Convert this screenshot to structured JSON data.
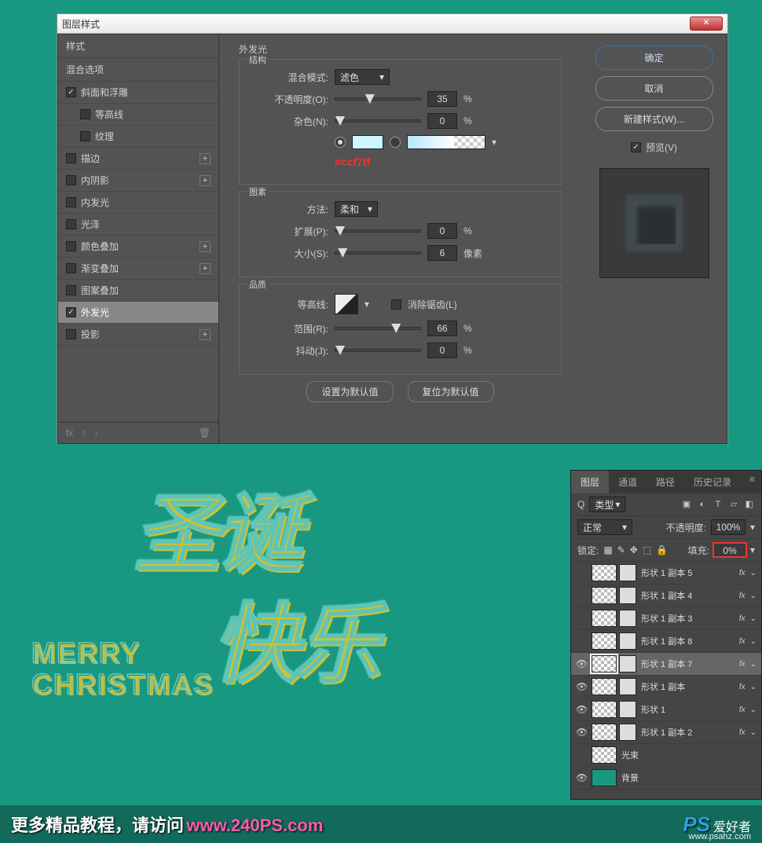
{
  "dialog": {
    "title": "图层样式",
    "close_label": "✕",
    "left": {
      "styles_header": "样式",
      "blend_header": "混合选项",
      "items": [
        {
          "label": "斜面和浮雕",
          "checked": true,
          "plus": false,
          "indent": 0
        },
        {
          "label": "等高线",
          "checked": false,
          "plus": false,
          "indent": 1
        },
        {
          "label": "纹理",
          "checked": false,
          "plus": false,
          "indent": 1
        },
        {
          "label": "描边",
          "checked": false,
          "plus": true,
          "indent": 0
        },
        {
          "label": "内阴影",
          "checked": false,
          "plus": true,
          "indent": 0
        },
        {
          "label": "内发光",
          "checked": false,
          "plus": false,
          "indent": 0
        },
        {
          "label": "光泽",
          "checked": false,
          "plus": false,
          "indent": 0
        },
        {
          "label": "颜色叠加",
          "checked": false,
          "plus": true,
          "indent": 0
        },
        {
          "label": "渐变叠加",
          "checked": false,
          "plus": true,
          "indent": 0
        },
        {
          "label": "图案叠加",
          "checked": false,
          "plus": false,
          "indent": 0
        },
        {
          "label": "外发光",
          "checked": true,
          "plus": false,
          "indent": 0,
          "selected": true
        },
        {
          "label": "投影",
          "checked": false,
          "plus": true,
          "indent": 0
        }
      ],
      "fx_label": "fx",
      "arrow_up": "↑",
      "arrow_down": "↓",
      "trash": "🗑"
    },
    "mid": {
      "title": "外发光",
      "struct": {
        "legend": "结构",
        "blend_label": "混合模式:",
        "blend_value": "滤色",
        "opacity_label": "不透明度(O):",
        "opacity_value": "35",
        "opacity_unit": "%",
        "noise_label": "杂色(N):",
        "noise_value": "0",
        "noise_unit": "%",
        "color_hex": "#ccf7ff",
        "color_swatch": "#ccf7ff"
      },
      "element": {
        "legend": "图素",
        "technique_label": "方法:",
        "technique_value": "柔和",
        "spread_label": "扩展(P):",
        "spread_value": "0",
        "spread_unit": "%",
        "size_label": "大小(S):",
        "size_value": "6",
        "size_unit": "像素"
      },
      "quality": {
        "legend": "品质",
        "contour_label": "等高线:",
        "antialias_label": "消除锯齿(L)",
        "range_label": "范围(R):",
        "range_value": "66",
        "range_unit": "%",
        "jitter_label": "抖动(J):",
        "jitter_value": "0",
        "jitter_unit": "%"
      },
      "set_default": "设置为默认值",
      "reset_default": "复位为默认值"
    },
    "right": {
      "ok": "确定",
      "cancel": "取消",
      "new_style": "新建样式(W)...",
      "preview_label": "预览(V)"
    }
  },
  "artwork": {
    "line1": "圣诞",
    "line2": "快乐",
    "sub1": "MERRY",
    "sub2": "CHRISTMAS"
  },
  "layers_panel": {
    "tabs": [
      "图层",
      "通道",
      "路径",
      "历史记录"
    ],
    "filter_icon": "Q",
    "filter_value": "类型",
    "blend_mode": "正常",
    "opacity_label": "不透明度:",
    "opacity_value": "100%",
    "lock_label": "锁定:",
    "fill_label": "填充:",
    "fill_value": "0%",
    "layers": [
      {
        "visible": false,
        "name": "形状 1 副本 5",
        "fx": true
      },
      {
        "visible": false,
        "name": "形状 1 副本 4",
        "fx": true
      },
      {
        "visible": false,
        "name": "形状 1 副本 3",
        "fx": true
      },
      {
        "visible": false,
        "name": "形状 1 副本 8",
        "fx": true
      },
      {
        "visible": true,
        "name": "形状 1 副本 7",
        "fx": true,
        "selected": true
      },
      {
        "visible": true,
        "name": "形状 1 副本",
        "fx": true
      },
      {
        "visible": true,
        "name": "形状 1",
        "fx": true
      },
      {
        "visible": true,
        "name": "形状 1 副本 2",
        "fx": true
      },
      {
        "visible": false,
        "name": "光束",
        "fx": false,
        "checker": true
      },
      {
        "visible": true,
        "name": "背景",
        "fx": false,
        "solid": true
      }
    ]
  },
  "footer": {
    "text": "更多精品教程，请访问",
    "link": "www.240PS.com",
    "logo_ps": "PS",
    "logo_cn": "爱好者",
    "logo_sub": "www.psahz.com"
  }
}
